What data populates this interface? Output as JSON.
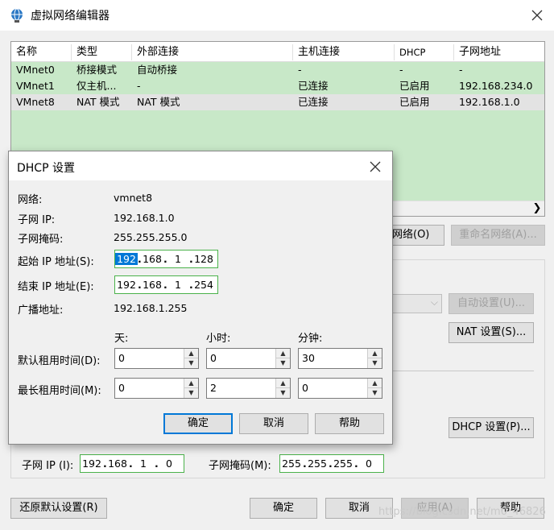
{
  "window": {
    "title": "虚拟网络编辑器",
    "icon": "network-globe-icon"
  },
  "table": {
    "columns": [
      "名称",
      "类型",
      "外部连接",
      "主机连接",
      "DHCP",
      "子网地址"
    ],
    "rows": [
      {
        "name": "VMnet0",
        "type": "桥接模式",
        "external": "自动桥接",
        "host": "-",
        "dhcp": "-",
        "subnet": "-"
      },
      {
        "name": "VMnet1",
        "type": "仅主机...",
        "external": "-",
        "host": "已连接",
        "dhcp": "已启用",
        "subnet": "192.168.234.0"
      },
      {
        "name": "VMnet8",
        "type": "NAT 模式",
        "external": "NAT 模式",
        "host": "已连接",
        "dhcp": "已启用",
        "subnet": "192.168.1.0"
      }
    ]
  },
  "side_buttons": {
    "network_partial": "网络(O)",
    "rename": "重命名网络(A)...",
    "auto_settings": "自动设置(U)...",
    "nat_settings": "NAT 设置(S)...",
    "dhcp_settings": "DHCP 设置(P)..."
  },
  "subnet_row": {
    "ip_label": "子网 IP (I):",
    "ip": [
      "192",
      "168",
      "1",
      "0"
    ],
    "mask_label": "子网掩码(M):",
    "mask": [
      "255",
      "255",
      "255",
      "0"
    ]
  },
  "bottom_buttons": {
    "restore": "还原默认设置(R)",
    "ok": "确定",
    "cancel": "取消",
    "apply": "应用(A)",
    "help": "帮助"
  },
  "watermark": "https://blog.csdn.net/m0_46826",
  "dhcp_dialog": {
    "title": "DHCP 设置",
    "network_label": "网络:",
    "network_value": "vmnet8",
    "subnet_ip_label": "子网 IP:",
    "subnet_ip_value": "192.168.1.0",
    "subnet_mask_label": "子网掩码:",
    "subnet_mask_value": "255.255.255.0",
    "start_ip_label": "起始 IP 地址(S):",
    "start_ip": [
      "192",
      "168",
      "1",
      "128"
    ],
    "end_ip_label": "结束 IP 地址(E):",
    "end_ip": [
      "192",
      "168",
      "1",
      "254"
    ],
    "broadcast_label": "广播地址:",
    "broadcast_value": "192.168.1.255",
    "col_days": "天:",
    "col_hours": "小时:",
    "col_minutes": "分钟:",
    "default_lease_label": "默认租用时间(D):",
    "default_lease": {
      "days": "0",
      "hours": "0",
      "minutes": "30"
    },
    "max_lease_label": "最长租用时间(M):",
    "max_lease": {
      "days": "0",
      "hours": "2",
      "minutes": "0"
    },
    "ok": "确定",
    "cancel": "取消",
    "help": "帮助"
  }
}
